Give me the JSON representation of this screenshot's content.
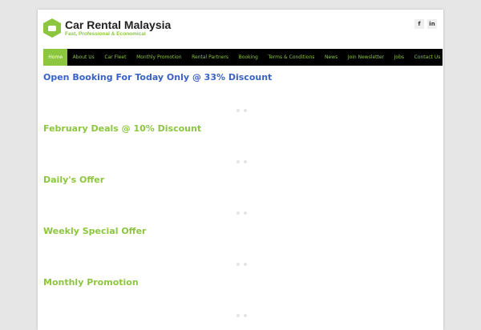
{
  "logo": {
    "title": "Car Rental Malaysia",
    "tagline": "Fast, Professional & Economical"
  },
  "social": {
    "facebook": "f",
    "linkedin": "in"
  },
  "nav": [
    "Home",
    "About Us",
    "Car Fleet",
    "Monthly Promotion",
    "Rental Partners",
    "Booking",
    "Terms & Conditions",
    "News",
    "Join Newsletter",
    "Jobs",
    "Contact Us"
  ],
  "sections": [
    "Open Booking For Today Only @ 33% Discount",
    "February Deals @ 10% Discount",
    "Daily's Offer",
    "Weekly Special Offer",
    "Monthly Promotion"
  ]
}
